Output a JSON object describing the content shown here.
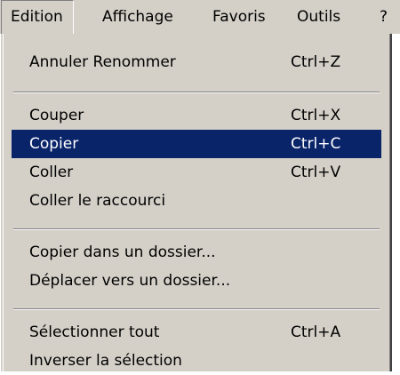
{
  "menubar": {
    "items": [
      {
        "label": "Edition"
      },
      {
        "label": "Affichage"
      },
      {
        "label": "Favoris"
      },
      {
        "label": "Outils"
      },
      {
        "label": "?"
      }
    ]
  },
  "menu": {
    "items": [
      {
        "label": "Annuler Renommer",
        "shortcut": "Ctrl+Z"
      },
      {
        "label": "Couper",
        "shortcut": "Ctrl+X"
      },
      {
        "label": "Copier",
        "shortcut": "Ctrl+C"
      },
      {
        "label": "Coller",
        "shortcut": "Ctrl+V"
      },
      {
        "label": "Coller le raccourci",
        "shortcut": ""
      },
      {
        "label": "Copier dans un dossier...",
        "shortcut": ""
      },
      {
        "label": "Déplacer vers un dossier...",
        "shortcut": ""
      },
      {
        "label": "Sélectionner tout",
        "shortcut": "Ctrl+A"
      },
      {
        "label": "Inverser la sélection",
        "shortcut": ""
      }
    ],
    "highlighted_item": "Copier"
  },
  "colors": {
    "menu_background": "#d4d0c8",
    "highlight_background": "#0a246a",
    "highlight_text": "#ffffff"
  }
}
